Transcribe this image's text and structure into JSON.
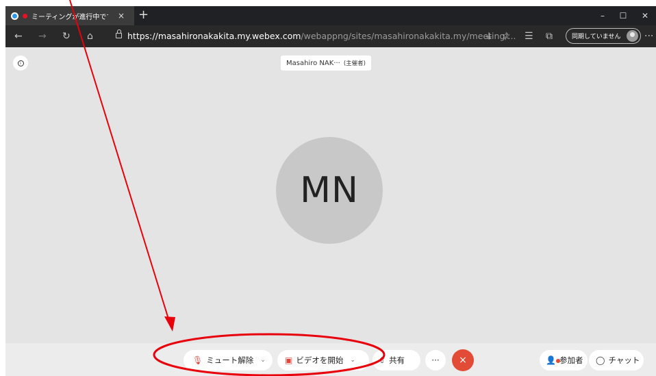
{
  "browser": {
    "tab_title": "ミーティングが進行中です...",
    "tab_close": "×",
    "new_tab": "+",
    "window_controls": [
      "–",
      "☐",
      "✕"
    ],
    "url_host_prefix": "https://",
    "url_host": "masahironakakita.my.webex.com",
    "url_path": "/webappng/sites/masahironakakita.my/meeting/...",
    "sync_label": "同期していません",
    "more": "···"
  },
  "meeting": {
    "participant_name": "Masahiro NAK···",
    "host_label": "(主催者)",
    "avatar_initials": "MN"
  },
  "controls": {
    "unmute_label": "ミュート解除",
    "start_video_label": "ビデオを開始",
    "share_label": "共有",
    "more_label": "···",
    "end_label": "×",
    "participants_label": "参加者",
    "chat_label": "チャット"
  },
  "colors": {
    "end_button": "#e24b36",
    "annotation": "#e8000b"
  }
}
